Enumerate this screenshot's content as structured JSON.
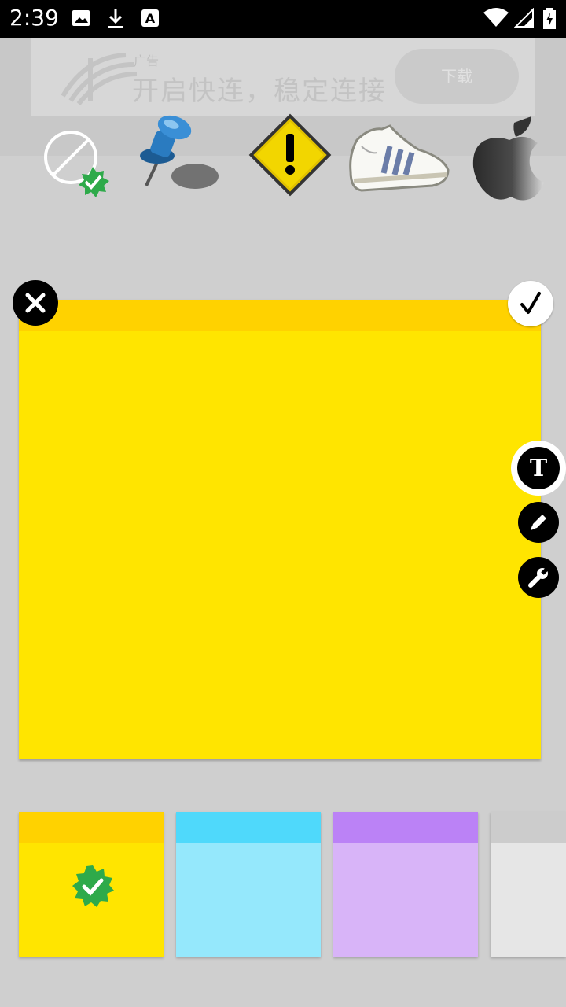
{
  "status_bar": {
    "time": "2:39"
  },
  "ad": {
    "small_text": "广告",
    "title": "开启快连，稳定连接",
    "button_label": "下载"
  },
  "stickers": [
    {
      "name": "no-sticker-selected-icon"
    },
    {
      "name": "pushpin-icon"
    },
    {
      "name": "warning-sign-icon"
    },
    {
      "name": "sneaker-icon"
    },
    {
      "name": "apple-logo-icon"
    }
  ],
  "note": {
    "color": "#ffe500",
    "header_color": "#ffd200",
    "text": ""
  },
  "tools": {
    "text_tool_glyph": "T"
  },
  "swatches": [
    {
      "name": "yellow",
      "head": "#ffd200",
      "body": "#ffe500",
      "selected": true
    },
    {
      "name": "blue",
      "head": "#4fd9fb",
      "body": "#95e8fc",
      "selected": false
    },
    {
      "name": "purple",
      "head": "#bb82f6",
      "body": "#d8b4f8",
      "selected": false
    },
    {
      "name": "gray",
      "head": "#cccccc",
      "body": "#e6e6e6",
      "selected": false
    }
  ]
}
